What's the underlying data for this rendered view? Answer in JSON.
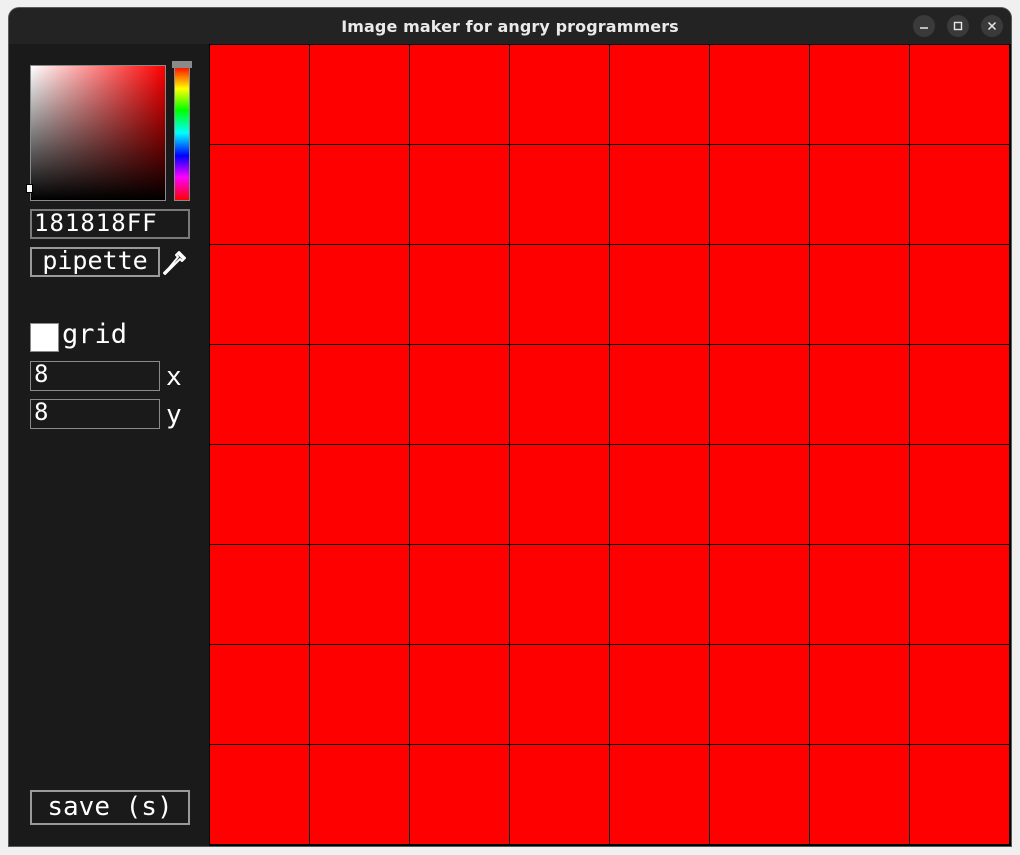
{
  "window": {
    "title": "Image maker for angry programmers",
    "controls": [
      "minimize-icon",
      "maximize-icon",
      "close-icon"
    ]
  },
  "color_picker": {
    "hex_value": "181818FF",
    "hue_color": "#ff0000",
    "pipette_label": "pipette",
    "pipette_icon": "eyedropper-icon"
  },
  "grid": {
    "label": "grid",
    "enabled": false,
    "x_value": "8",
    "x_label": "x",
    "y_value": "8",
    "y_label": "y"
  },
  "canvas": {
    "columns": 8,
    "rows": 8,
    "fill_color": "#ff0000",
    "grid_line_color": "#000000"
  },
  "save_label": "save (s)"
}
